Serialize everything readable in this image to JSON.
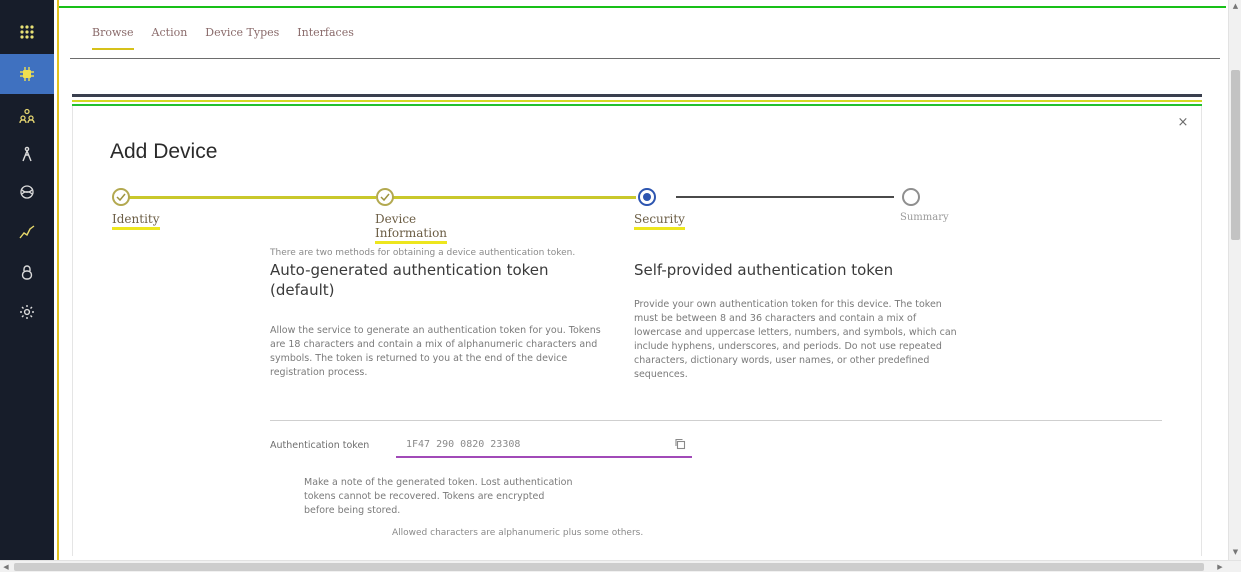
{
  "nav_rail": {
    "items": [
      {
        "icon": "app-switcher-icon"
      },
      {
        "icon": "devices-icon"
      },
      {
        "icon": "members-icon"
      },
      {
        "icon": "rules-icon"
      },
      {
        "icon": "extensions-icon"
      },
      {
        "icon": "usage-icon"
      },
      {
        "icon": "security-icon"
      },
      {
        "icon": "settings-icon"
      }
    ],
    "accent": "#3f71c0"
  },
  "tabs": [
    {
      "label": "Browse",
      "active": true
    },
    {
      "label": "Action",
      "active": false
    },
    {
      "label": "Device Types",
      "active": false
    },
    {
      "label": "Interfaces",
      "active": false
    }
  ],
  "dialog": {
    "title": "Add Device",
    "close_glyph": "×",
    "steps": [
      {
        "label": "Identity",
        "state": "done"
      },
      {
        "label": "Device Information",
        "state": "done"
      },
      {
        "label": "Security",
        "state": "current"
      },
      {
        "label": "Summary",
        "state": "todo"
      }
    ],
    "intro": "There are two methods for obtaining a device authentication token.",
    "options": [
      {
        "title": "Auto-generated authentication token (default)",
        "description": "Allow the service to generate an authentication token for you. Tokens are 18 characters and contain a mix of alphanumeric characters and symbols. The token is returned to you at the end of the device registration process."
      },
      {
        "title": "Self-provided authentication token",
        "description": "Provide your own authentication token for this device. The token must be between 8 and 36 characters and contain a mix of lowercase and uppercase letters, numbers, and symbols, which can include hyphens, underscores, and periods. Do not use repeated characters, dictionary words, user names, or other predefined sequences."
      }
    ],
    "token_label": "Authentication token",
    "token_value": "1F47 290 0820 23308",
    "hint": "Make a note of the generated token. Lost authentication tokens cannot be recovered. Tokens are encrypted before being stored.",
    "allowed": "Allowed characters are alphanumeric plus some others."
  },
  "colors": {
    "rail_bg": "#171d2a",
    "step_done": "#c9c82b",
    "step_current": "#2d55b0",
    "field_underline": "#a14ab8"
  }
}
